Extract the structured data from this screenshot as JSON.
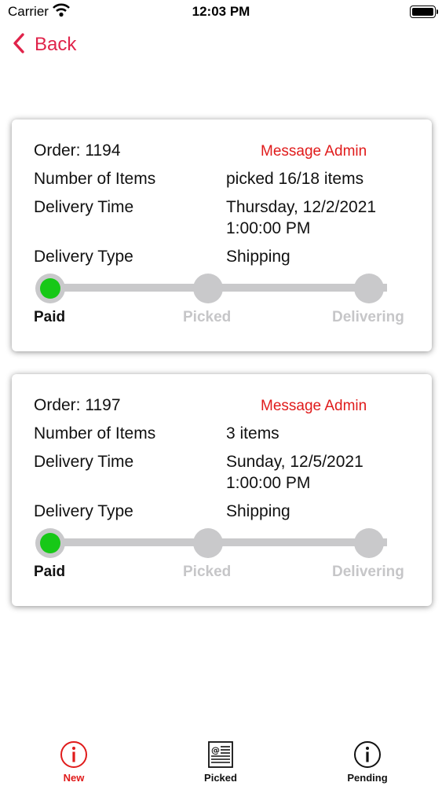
{
  "status_bar": {
    "carrier": "Carrier",
    "time": "12:03 PM"
  },
  "nav": {
    "back_label": "Back"
  },
  "orders": [
    {
      "order_label": "Order: 1194",
      "message_admin": "Message Admin",
      "items_label": "Number of Items",
      "items_value": "picked 16/18 items",
      "delivery_time_label": "Delivery Time",
      "delivery_time_line1": "Thursday, 12/2/2021",
      "delivery_time_line2": "1:00:00 PM",
      "delivery_type_label": "Delivery Type",
      "delivery_type_value": "Shipping",
      "steps": [
        "Paid",
        "Picked",
        "Delivering"
      ],
      "current_step": 1
    },
    {
      "order_label": "Order: 1197",
      "message_admin": "Message Admin",
      "items_label": "Number of Items",
      "items_value": "3 items",
      "delivery_time_label": "Delivery Time",
      "delivery_time_line1": "Sunday, 12/5/2021",
      "delivery_time_line2": "1:00:00 PM",
      "delivery_type_label": "Delivery Type",
      "delivery_type_value": "Shipping",
      "steps": [
        "Paid",
        "Picked",
        "Delivering"
      ],
      "current_step": 1
    }
  ],
  "tab_bar": {
    "tabs": [
      {
        "label": "New",
        "icon": "info-circle-icon",
        "active": true
      },
      {
        "label": "Picked",
        "icon": "newspaper-icon",
        "active": false
      },
      {
        "label": "Pending",
        "icon": "info-circle-icon",
        "active": false
      }
    ]
  },
  "colors": {
    "accent": "#e0234a",
    "message_admin": "#e01b1b",
    "step_done": "#17c817",
    "step_pending": "#c9c9cb"
  }
}
